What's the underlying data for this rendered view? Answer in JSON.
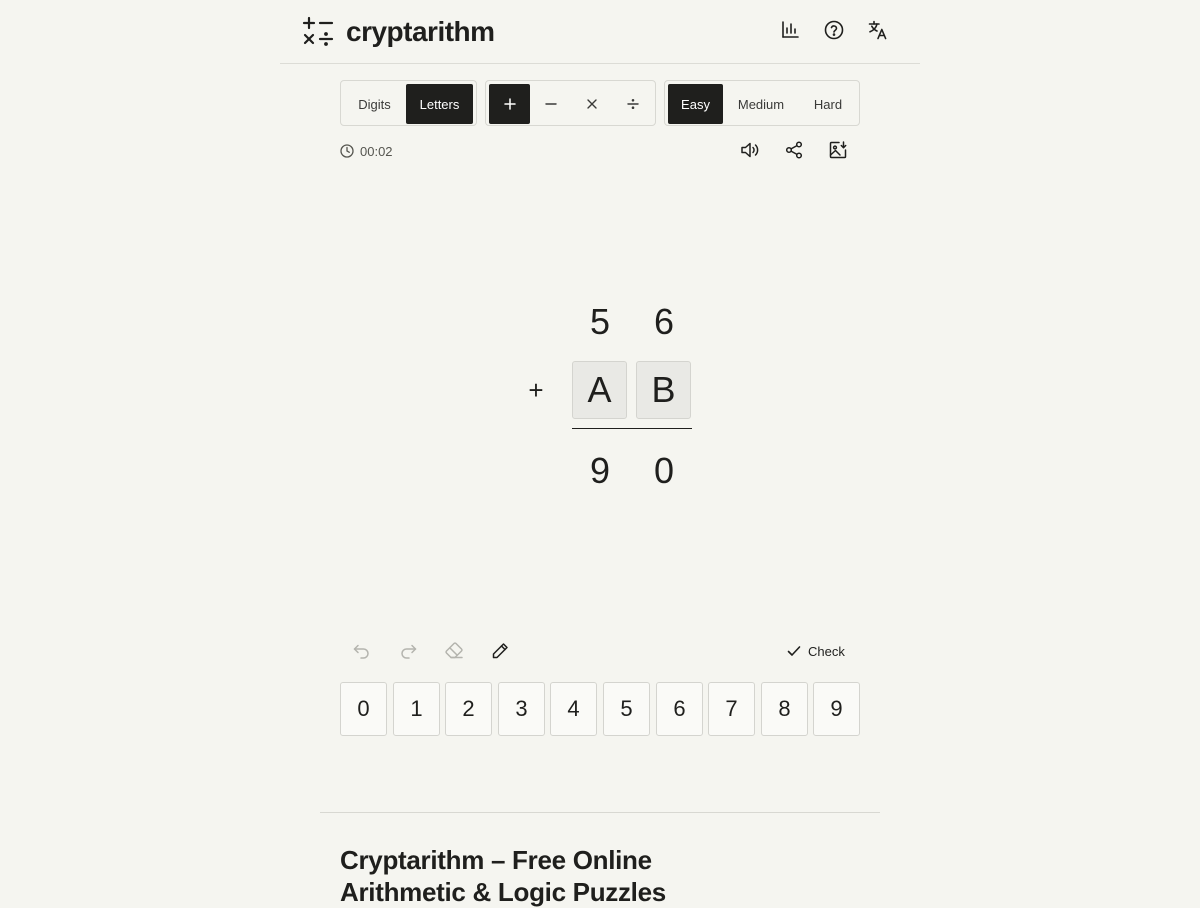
{
  "app": {
    "title": "cryptarithm"
  },
  "header": {
    "icons": [
      "stats-icon",
      "help-icon",
      "translate-icon"
    ]
  },
  "mode": {
    "options": [
      "Digits",
      "Letters"
    ],
    "selected": "Letters"
  },
  "operations": {
    "options": [
      "+",
      "−",
      "×",
      "÷"
    ],
    "selected": "+"
  },
  "difficulty": {
    "options": [
      "Easy",
      "Medium",
      "Hard"
    ],
    "selected": "Easy"
  },
  "timer": {
    "value": "00:02"
  },
  "puzzle": {
    "operator": "+",
    "row1": [
      "5",
      "6"
    ],
    "row2": [
      "A",
      "B"
    ],
    "result": [
      "9",
      "0"
    ]
  },
  "actions": {
    "check_label": "Check"
  },
  "keypad": [
    "0",
    "1",
    "2",
    "3",
    "4",
    "5",
    "6",
    "7",
    "8",
    "9"
  ],
  "article": {
    "title": "Cryptarithm – Free Online Arithmetic & Logic Puzzles"
  },
  "colors": {
    "accent": "#1f1f1d",
    "background": "#f5f5f0",
    "cell": "#e9e9e5"
  }
}
